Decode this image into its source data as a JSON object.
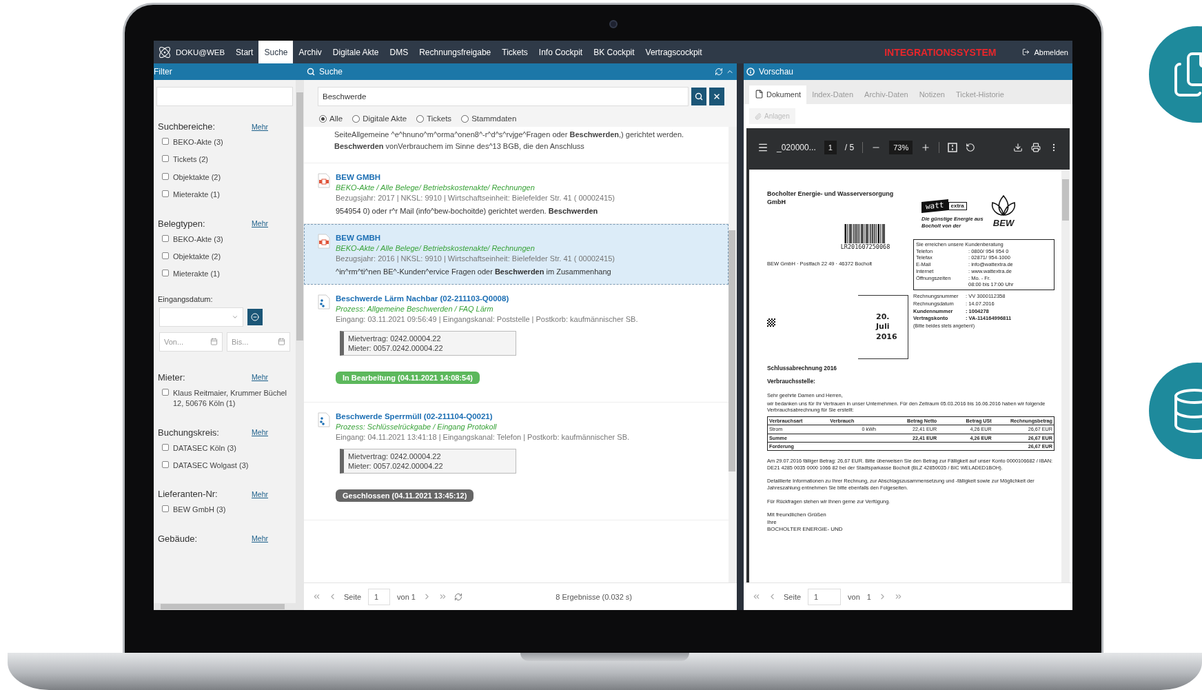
{
  "nav": {
    "brand": "DOKU@WEB",
    "items": [
      {
        "label": "Start",
        "selected": false
      },
      {
        "label": "Suche",
        "selected": true
      },
      {
        "label": "Archiv",
        "selected": false
      },
      {
        "label": "Digitale Akte",
        "selected": false
      },
      {
        "label": "DMS",
        "selected": false
      },
      {
        "label": "Rechnungsfreigabe",
        "selected": false
      },
      {
        "label": "Tickets",
        "selected": false
      },
      {
        "label": "Info Cockpit",
        "selected": false
      },
      {
        "label": "BK Cockpit",
        "selected": false
      },
      {
        "label": "Vertragscockpit",
        "selected": false
      }
    ],
    "system_label": "INTEGRATIONSSYSTEM",
    "logout": "Abmelden"
  },
  "filter": {
    "title": "Filter",
    "sections": [
      {
        "kind": "checklist",
        "title": "Suchbereiche:",
        "more": "Mehr",
        "items": [
          {
            "label": "BEKO-Akte (3)",
            "checked": false
          },
          {
            "label": "Tickets (2)",
            "checked": false
          },
          {
            "label": "Objektakte (2)",
            "checked": false
          },
          {
            "label": "Mieterakte (1)",
            "checked": false
          }
        ]
      },
      {
        "kind": "checklist",
        "title": "Belegtypen:",
        "more": "Mehr",
        "items": [
          {
            "label": "BEKO-Akte (3)",
            "checked": false
          },
          {
            "label": "Objektakte (2)",
            "checked": false
          },
          {
            "label": "Mieterakte (1)",
            "checked": false
          }
        ]
      },
      {
        "kind": "date",
        "title": "Eingangsdatum:",
        "from_placeholder": "Von...",
        "to_placeholder": "Bis..."
      },
      {
        "kind": "checklist",
        "title": "Mieter:",
        "more": "Mehr",
        "items": [
          {
            "label": "Klaus Reitmaier, Krummer Büchel 12, 50676 Köln (1)",
            "checked": false
          }
        ]
      },
      {
        "kind": "checklist",
        "title": "Buchungskreis:",
        "more": "Mehr",
        "items": [
          {
            "label": "DATASEC Köln (3)",
            "checked": false
          },
          {
            "label": "DATASEC Wolgast (3)",
            "checked": false
          }
        ]
      },
      {
        "kind": "checklist",
        "title": "Lieferanten-Nr:",
        "more": "Mehr",
        "items": [
          {
            "label": "BEW GmbH (3)",
            "checked": false
          }
        ]
      },
      {
        "kind": "checklist",
        "title": "Gebäude:",
        "more": "Mehr"
      }
    ]
  },
  "search": {
    "title": "Suche",
    "query": "Beschwerde",
    "scopes": [
      {
        "label": "Alle",
        "selected": true
      },
      {
        "label": "Digitale Akte",
        "selected": false
      },
      {
        "label": "Tickets",
        "selected": false
      },
      {
        "label": "Stammdaten",
        "selected": false
      }
    ],
    "results": [
      {
        "kind": "snippet",
        "lines": [
          "SeiteAllgemeine ^e^hnuno^m^orma^onen8^-r^d^s^rvjge^Fragen oder **Beschwerden**,) gerichtet werden.",
          "**Beschwerden** vonVerbrauchem im Sinne des^13 BGB, die den Anschluss"
        ]
      },
      {
        "kind": "document",
        "selected": false,
        "title": "BEW GMBH",
        "path": "BEKO-Akte / Alle Belege/ Betriebskostenakte/ Rechnungen",
        "meta": "Bezugsjahr: 2017 | NKSL: 9910 | Wirtschaftseinheit: Bielefelder Str. 41 ( 00002415)",
        "snippet": "954954 0) oder r^r Mail (info^bew-bochoitde) gerichtet werden. **Beschwerden**"
      },
      {
        "kind": "document",
        "selected": true,
        "title": "BEW GMBH",
        "path": "BEKO-Akte / Alle Belege/ Betriebskostenakte/ Rechnungen",
        "meta": "Bezugsjahr: 2016 | NKSL: 9910 | Wirtschaftseinheit: Bielefelder Str. 41 ( 00002415)",
        "snippet": "^in^rm^ti^nen BE^-Kunden^ervice Fragen oder **Beschwerden** im Zusammenhang"
      },
      {
        "kind": "ticket",
        "selected": false,
        "title": "Beschwerde Lärm Nachbar (02-211103-Q0008)",
        "path": "Prozess: Allgemeine Beschwerden / FAQ Lärm",
        "meta": "Eingang: 03.11.2021 09:56:49 | Eingangskanal: Poststelle | Postkorb: kaufmännischer SB.",
        "refs": [
          "Mietvertrag: 0242.00004.22",
          "Mieter: 0057.0242.00004.22"
        ],
        "status": {
          "kind": "in_progress",
          "label": "In Bearbeitung (04.11.2021 14:08:54)"
        }
      },
      {
        "kind": "ticket",
        "selected": false,
        "title": "Beschwerde Sperrmüll (02-211104-Q0021)",
        "path": "Prozess: Schlüsselrückgabe / Eingang Protokoll",
        "meta": "Eingang: 04.11.2021 13:41:18 | Eingangskanal: Telefon | Postkorb: kaufmännischer SB.",
        "refs": [
          "Mietvertrag: 0242.00004.22",
          "Mieter: 0057.0242.00004.22"
        ],
        "status": {
          "kind": "closed",
          "label": "Geschlossen (04.11.2021 13:45:12)"
        }
      }
    ],
    "pager": {
      "label": "Seite",
      "page": "1",
      "of": "von 1",
      "summary": "8 Ergebnisse (0.032 s)"
    }
  },
  "preview": {
    "title": "Vorschau",
    "tabs": [
      {
        "label": "Dokument",
        "selected": true
      },
      {
        "label": "Index-Daten",
        "selected": false
      },
      {
        "label": "Archiv-Daten",
        "selected": false
      },
      {
        "label": "Notizen",
        "selected": false
      },
      {
        "label": "Ticket-Historie",
        "selected": false
      }
    ],
    "attachments": {
      "label": "Anlagen",
      "disabled": true
    },
    "viewer": {
      "filename": "_020000...",
      "page": "1",
      "pages": "/ 5",
      "zoom": "73%"
    },
    "document": {
      "company": "Bocholter Energie- und Wasserversorgung GmbH",
      "barcode_number": "LR201607250068",
      "sender": "BEW GmbH · Postfach 22 49 · 46372 Bocholt",
      "stamp": "20. Juli 2016",
      "logo": {
        "word": "watt",
        "badge": "extra",
        "tagline": "Die günstige Energie aus Bocholt von der",
        "brand": "BEW"
      },
      "contact_title": "Sie erreichen unsere Kundenberatung",
      "contact": [
        {
          "label": "Telefon",
          "value": ": 0800/ 954 954 0"
        },
        {
          "label": "Telefax",
          "value": ": 02871/ 954-1000"
        },
        {
          "label": "E-Mail",
          "value": ": info@wattextra.de"
        },
        {
          "label": "Internet",
          "value": ": www.wattextra.de"
        },
        {
          "label": "Öffnungszeiten",
          "value": ": Mo. - Fr."
        },
        {
          "value": "08:00 bis 17:00 Uhr"
        }
      ],
      "info": [
        [
          "Rechnungsnummer",
          ": VV 3000112358"
        ],
        [
          "Rechnungsdatum",
          ": 14.07.2016"
        ],
        [
          "Kundennummer",
          ": 1004278"
        ],
        [
          "Vertragskonto",
          ": VA-114164996811"
        ]
      ],
      "info_note": "(Bitte beides stets angeben!)",
      "heading": "Schlussabrechnung 2016",
      "subheading": "Verbrauchsstelle:",
      "salutation": "Sehr geehrte Damen und Herren,",
      "intro": "wir bedanken uns für Ihr Vertrauen in unser Unternehmen. Für den Zeitraum 05.03.2016 bis 16.06.2016 haben wir folgende Verbrauchsabrechnung für Sie erstellt:",
      "table": {
        "columns": [
          "Verbrauchsart",
          "Verbrauch",
          "Betrag Netto",
          "Betrag USt",
          "Rechnungsbetrag"
        ],
        "rows": [
          {
            "bold": false,
            "cells": [
              "Strom",
              "0  kWh",
              "22,41 EUR",
              "4,26 EUR",
              "26,67 EUR"
            ]
          },
          {
            "bold": true,
            "cells": [
              "Summe",
              "",
              "22,41 EUR",
              "4,26 EUR",
              "26,67 EUR"
            ]
          },
          {
            "bold": true,
            "cells": [
              "Forderung",
              "",
              "",
              "",
              "26,67 EUR"
            ]
          }
        ]
      },
      "paragraphs": [
        "Am 29.07.2016 fälliger Betrag: 26,67 EUR. Bitte überweisen Sie den Betrag zur Fälligkeit auf unser Konto 0000106682 / IBAN: DE21 4285 0035 0000 1066 82 bei der Stadtsparkasse Bocholt (BLZ 42850035 / BIC WELADED1BOH).",
        "Detaillierte Informationen zu Ihrer Rechnung, zur Abschlagszusammensetzung und -fälligkeit sowie zur Möglichkeit der Jahreszahlung entnehmen Sie bitte ebenfalls den Folgeseiten.",
        "Für Rückfragen stehen wir Ihnen gerne zur Verfügung."
      ],
      "closing": [
        "Mit freundlichen Grüßen",
        "Ihre",
        "BOCHOLTER ENERGIE- UND"
      ]
    },
    "pager": {
      "label": "Seite",
      "page": "1",
      "of": "von",
      "total": "1"
    }
  }
}
